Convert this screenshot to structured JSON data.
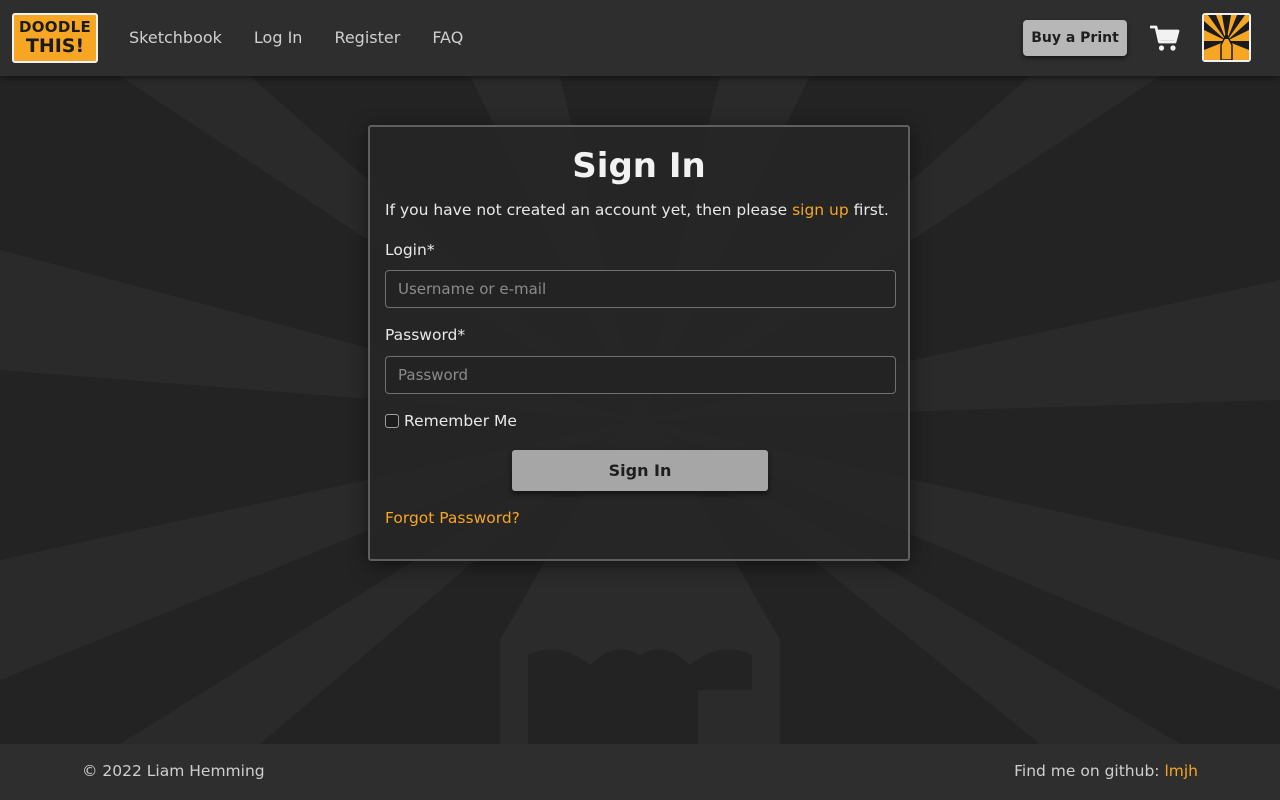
{
  "nav": {
    "logo_line1": "DOODLE",
    "logo_line2": "THIS!",
    "links": [
      "Sketchbook",
      "Log In",
      "Register",
      "FAQ"
    ],
    "buy_print": "Buy a Print",
    "cart_icon": "shopping-cart-icon",
    "profile_icon": "sunburst-pencil-avatar"
  },
  "signin": {
    "title": "Sign In",
    "intro_before": "If you have not created an account yet, then please ",
    "intro_link": "sign up",
    "intro_after": " first.",
    "login_label": "Login*",
    "login_placeholder": "Username or e-mail",
    "login_value": "",
    "password_label": "Password*",
    "password_placeholder": "Password",
    "password_value": "",
    "remember_label": "Remember Me",
    "remember_checked": false,
    "submit_label": "Sign In",
    "forgot_label": "Forgot Password?"
  },
  "footer": {
    "copyright": "© 2022 Liam Hemming",
    "github_prefix": "Find me on github: ",
    "github_link": "lmjh"
  },
  "colors": {
    "accent": "#f6a623",
    "background": "#232323",
    "panel": "#2e2e2e"
  }
}
